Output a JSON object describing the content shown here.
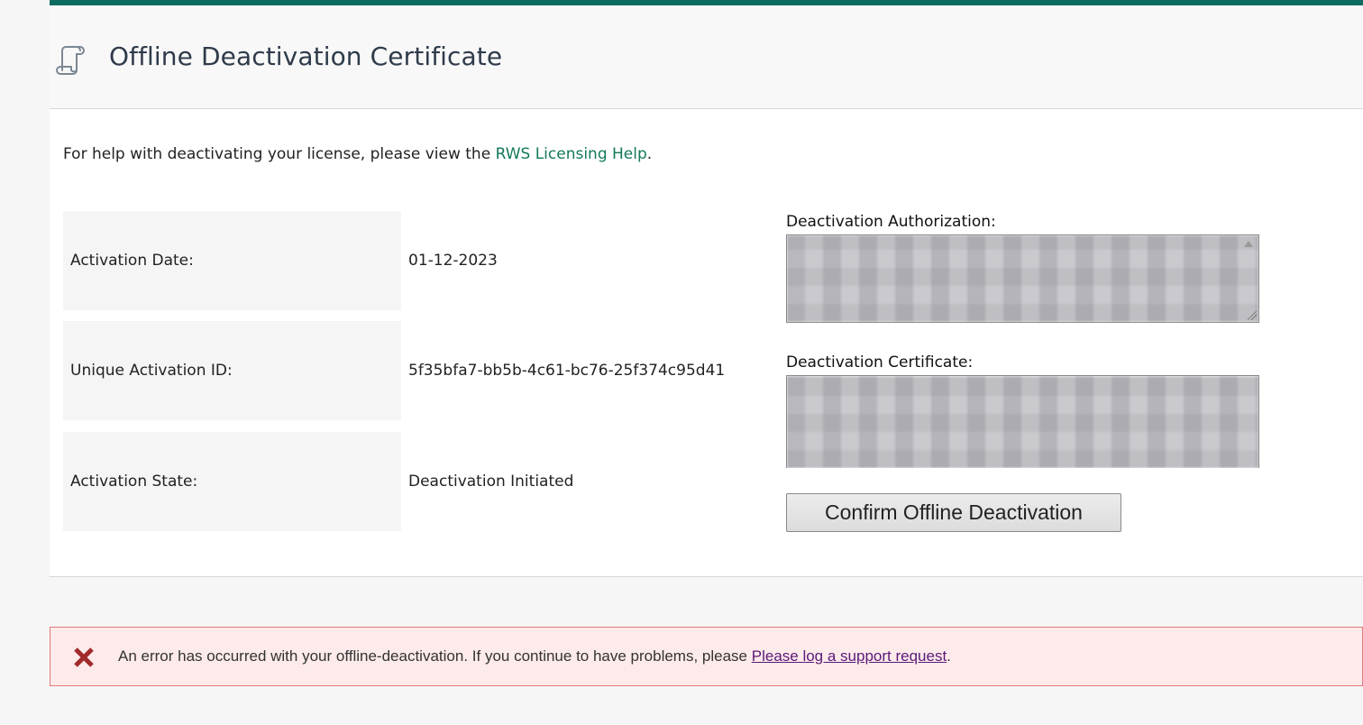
{
  "header": {
    "title": "Offline Deactivation Certificate",
    "icon": "scroll-icon",
    "accent_color": "#0e6b61"
  },
  "help": {
    "prefix": "For help with deactivating your license, please view the ",
    "link_text": "RWS Licensing Help",
    "suffix": "."
  },
  "activation_info": [
    {
      "label": "Activation Date:",
      "value": "01-12-2023"
    },
    {
      "label": "Unique Activation ID:",
      "value": "5f35bfa7-bb5b-4c61-bc76-25f374c95d41"
    },
    {
      "label": "Activation State:",
      "value": "Deactivation Initiated"
    }
  ],
  "fields": {
    "authorization_label": "Deactivation Authorization:",
    "certificate_label": "Deactivation Certificate:"
  },
  "actions": {
    "confirm_label": "Confirm Offline Deactivation"
  },
  "error": {
    "icon": "error-x-icon",
    "message": "An error has occurred with your offline-deactivation. If you continue to have problems, please ",
    "link_text": "Please log a support request",
    "suffix": ".",
    "color": "#a12a2a"
  }
}
